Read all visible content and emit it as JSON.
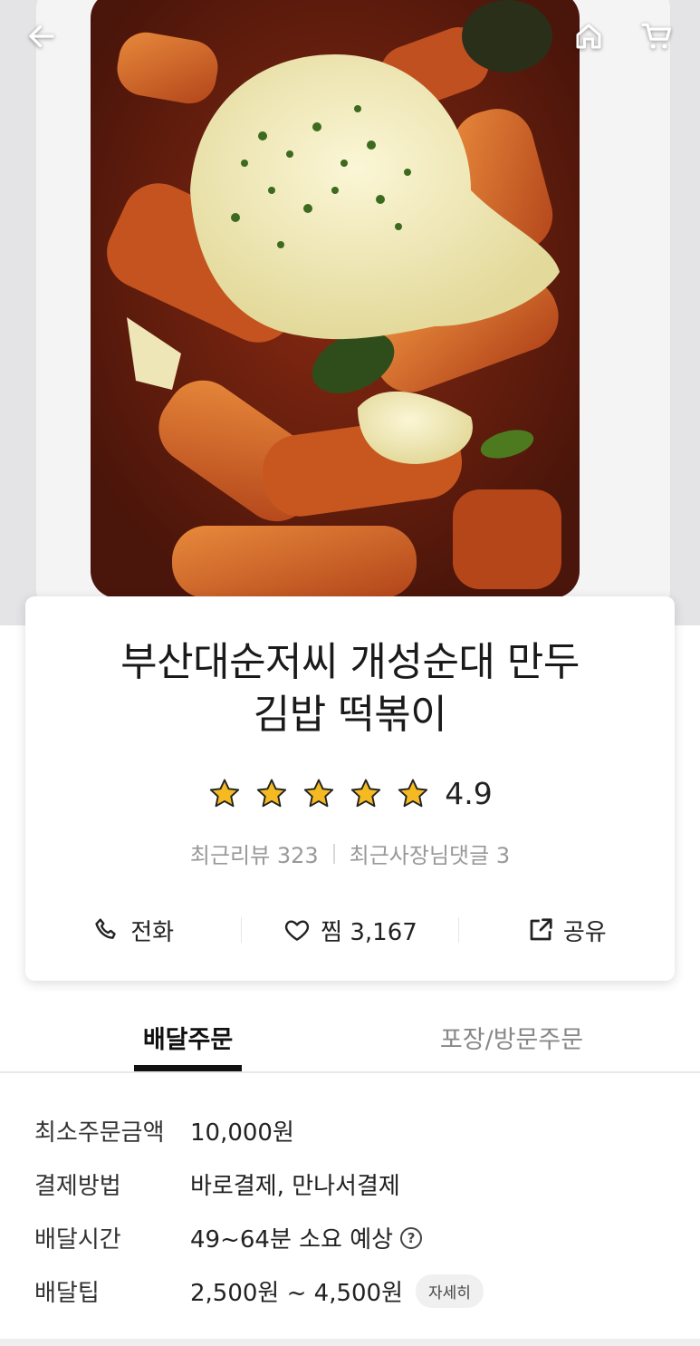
{
  "header": {
    "back_icon": "arrow-left-icon",
    "home_icon": "home-icon",
    "cart_icon": "cart-icon"
  },
  "store": {
    "name_line1": "부산대순저씨 개성순대 만두",
    "name_line2": "김밥 떡볶이",
    "rating": "4.9",
    "rating_value": 4.9,
    "star_count": 5,
    "star_color": "#F5B921",
    "recent_reviews": "최근리뷰 323",
    "owner_replies": "최근사장님댓글 3"
  },
  "actions": {
    "call_label": "전화",
    "like_label": "찜 3,167",
    "share_label": "공유"
  },
  "tabs": {
    "delivery": "배달주문",
    "pickup": "포장/방문주문",
    "active": "delivery"
  },
  "info": [
    {
      "label": "최소주문금액",
      "value": "10,000원"
    },
    {
      "label": "결제방법",
      "value": "바로결제, 만나서결제"
    },
    {
      "label": "배달시간",
      "value": "49~64분 소요 예상",
      "help": "?"
    },
    {
      "label": "배달팁",
      "value": "2,500원 ~ 4,500원",
      "detail": "자세히"
    }
  ]
}
